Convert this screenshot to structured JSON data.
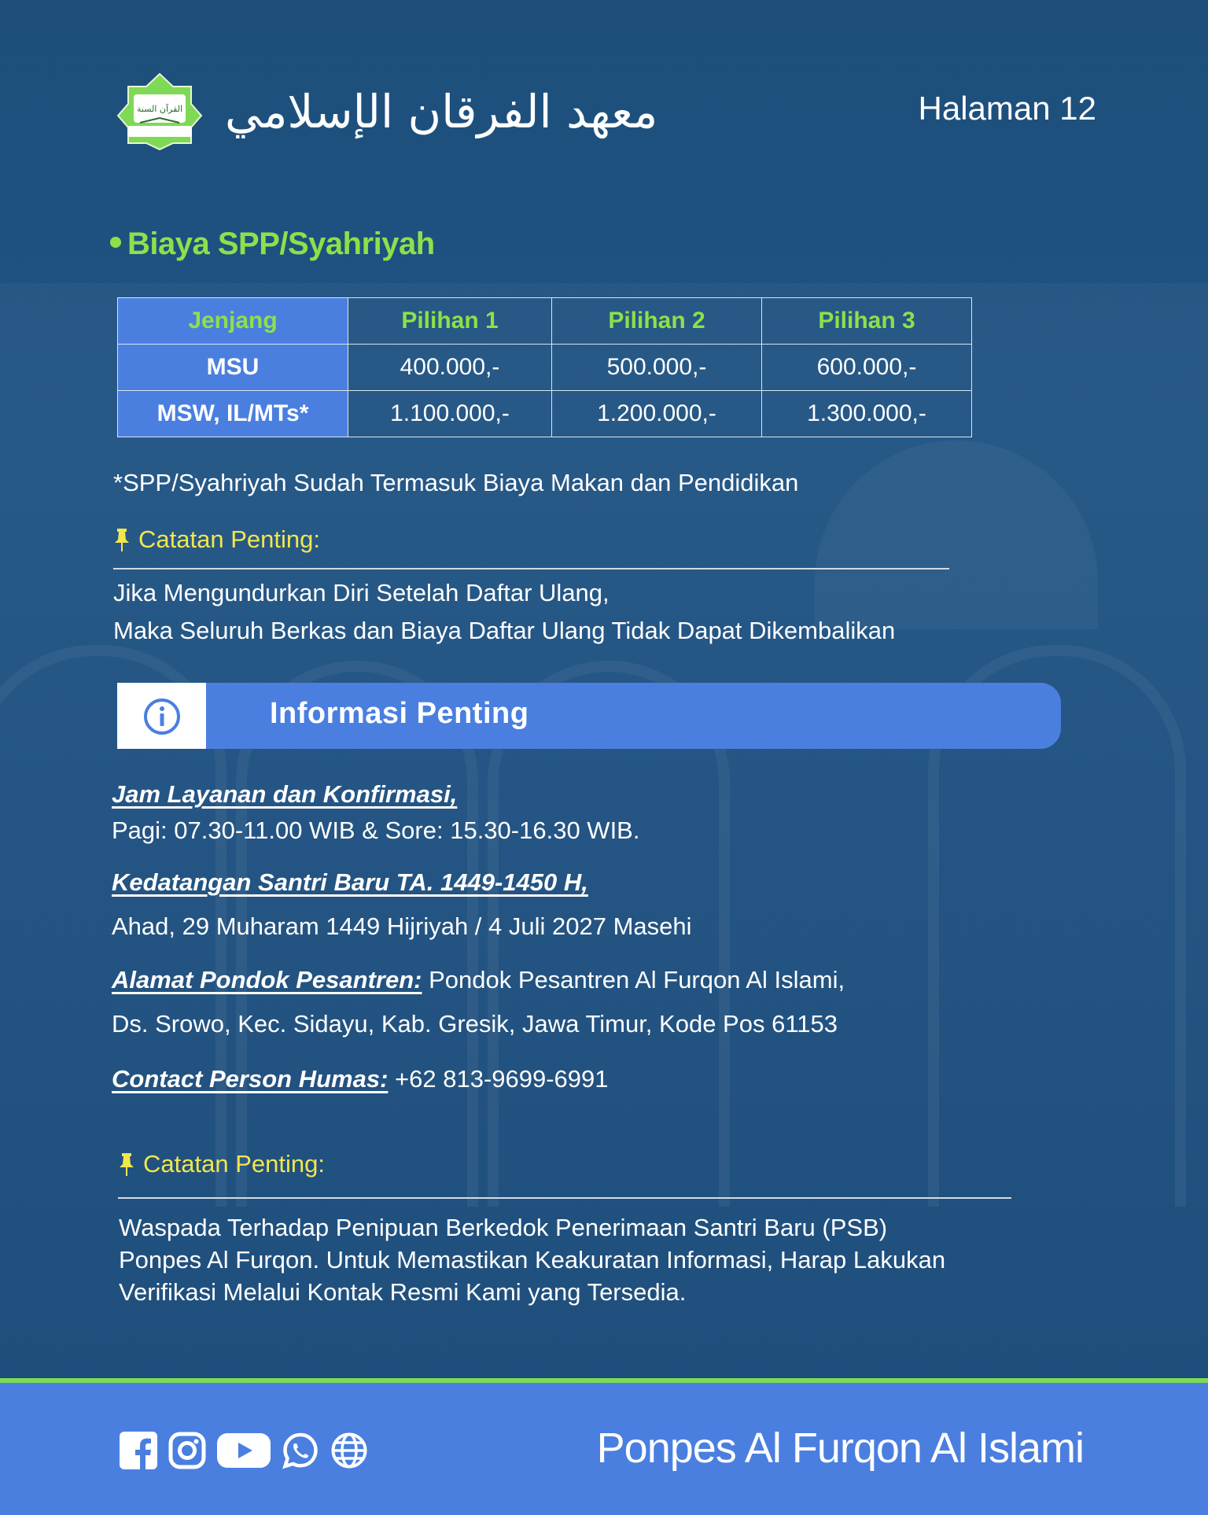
{
  "header": {
    "arabic_title": "معهد الفرقان الإسلامي",
    "logo_top_text": "القرآن السنة",
    "page_label": "Halaman 12"
  },
  "fees": {
    "title": "Biaya SPP/Syahriyah",
    "columns": [
      "Jenjang",
      "Pilihan 1",
      "Pilihan 2",
      "Pilihan 3"
    ],
    "rows": [
      {
        "level": "MSU",
        "values": [
          "400.000,-",
          "500.000,-",
          "600.000,-"
        ]
      },
      {
        "level": "MSW, IL/MTs*",
        "values": [
          "1.100.000,-",
          "1.200.000,-",
          "1.300.000,-"
        ]
      }
    ],
    "note": "*SPP/Syahriyah Sudah Termasuk Biaya Makan dan Pendidikan"
  },
  "note1": {
    "title": "Catatan Penting:",
    "lines": [
      "Jika Mengundurkan Diri Setelah Daftar Ulang,",
      "Maka Seluruh Berkas dan Biaya Daftar Ulang Tidak Dapat Dikembalikan"
    ]
  },
  "info": {
    "banner": "Informasi Penting",
    "hours_title": "Jam Layanan dan Konfirmasi,",
    "hours_text": "Pagi: 07.30-11.00 WIB & Sore: 15.30-16.30 WIB.",
    "arrival_title": "Kedatangan Santri Baru TA. 1449-1450 H,",
    "arrival_text": "Ahad, 29 Muharam 1449  Hijriyah / 4 Juli 2027 Masehi",
    "address_title": "Alamat Pondok Pesantren:",
    "address_text1": "Pondok Pesantren Al Furqon Al Islami,",
    "address_text2": "Ds. Srowo, Kec. Sidayu, Kab. Gresik, Jawa Timur, Kode Pos 61153",
    "contact_title": "Contact Person Humas:",
    "contact_text": "+62 813-9699-6991"
  },
  "note2": {
    "title": "Catatan Penting:",
    "lines": [
      "Waspada Terhadap Penipuan Berkedok Penerimaan Santri Baru (PSB)",
      "Ponpes Al Furqon. Untuk Memastikan Keakuratan Informasi, Harap Lakukan",
      "Verifikasi Melalui Kontak Resmi Kami yang Tersedia."
    ]
  },
  "footer": {
    "brand": "Ponpes Al Furqon Al Islami",
    "icons": [
      "facebook-icon",
      "instagram-icon",
      "youtube-icon",
      "whatsapp-icon",
      "globe-icon"
    ]
  },
  "colors": {
    "background": "#1f5383",
    "accent_blue": "#4a7fe0",
    "green": "#8ee04a",
    "yellow": "#f2e64d"
  }
}
